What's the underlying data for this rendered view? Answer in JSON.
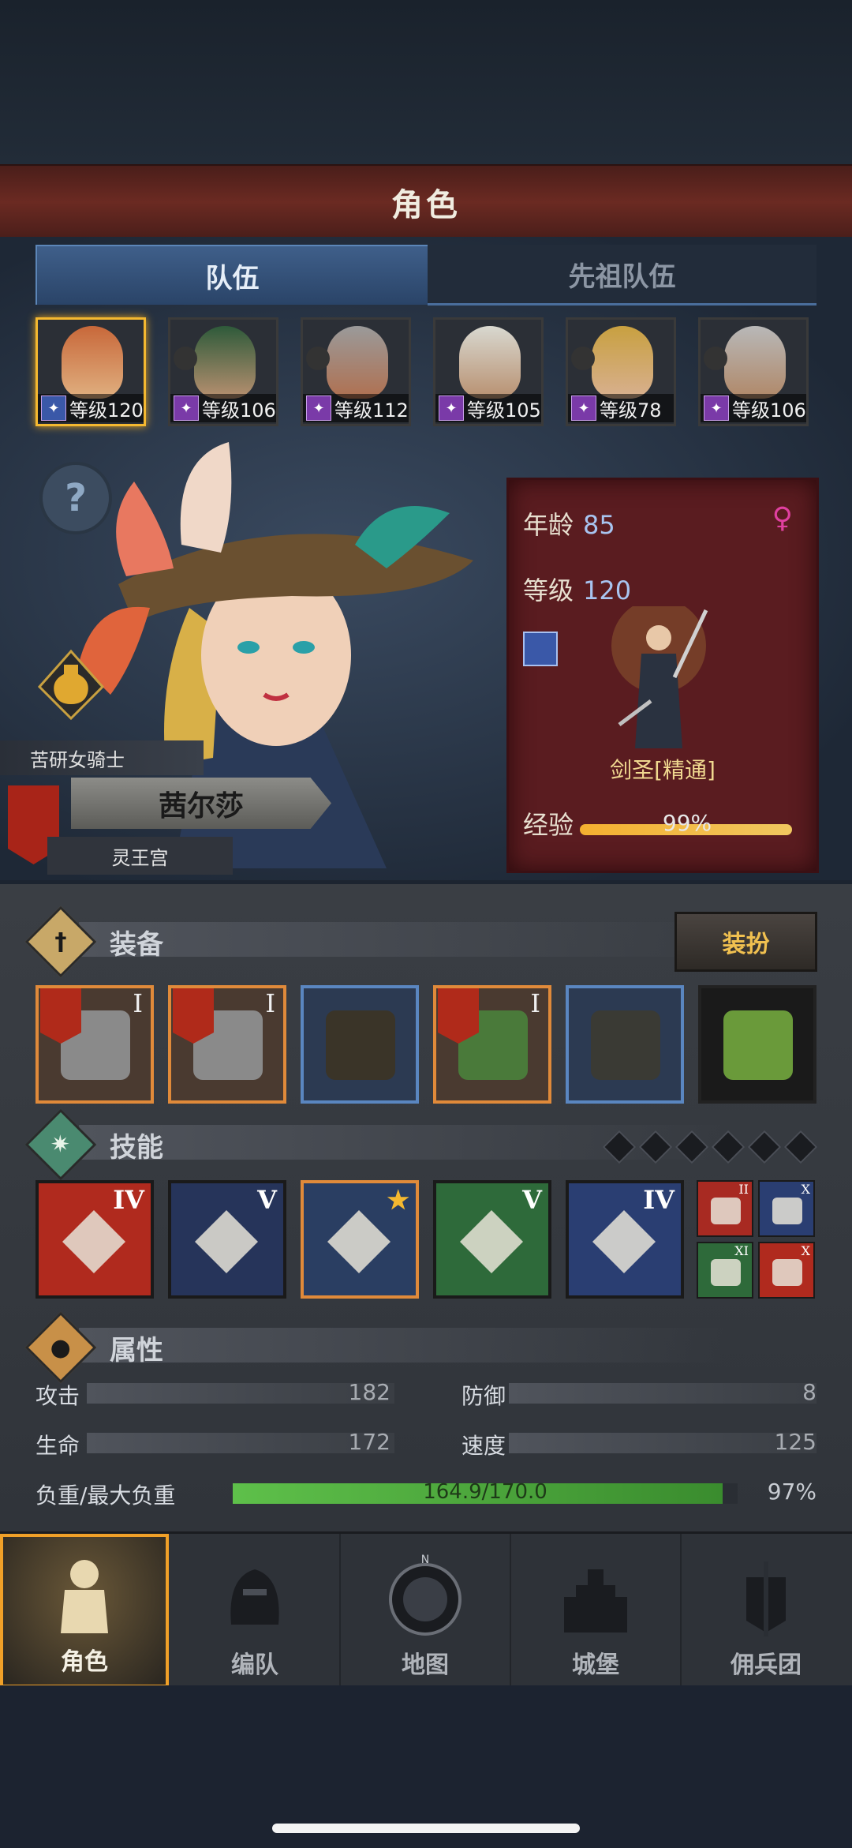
{
  "header": {
    "title": "角色"
  },
  "tabs": [
    {
      "label": "队伍"
    },
    {
      "label": "先祖队伍"
    }
  ],
  "party": [
    {
      "level_label": "等级120"
    },
    {
      "level_label": "等级106"
    },
    {
      "level_label": "等级112"
    },
    {
      "level_label": "等级105"
    },
    {
      "level_label": "等级78"
    },
    {
      "level_label": "等级106"
    }
  ],
  "hero": {
    "title": "苦研女骑士",
    "name": "茜尔莎",
    "faction": "灵王宫",
    "help_symbol": "?"
  },
  "info": {
    "age_label": "年龄",
    "age": "85",
    "gender_symbol": "♀",
    "level_label": "等级",
    "level": "120",
    "job": "剑圣[精通]",
    "exp_label": "经验",
    "exp_pct": "99%",
    "exp_fraction": 0.99
  },
  "equipment": {
    "title": "装备",
    "dress_button": "装扮",
    "slots": [
      {
        "icon": "halberd-icon",
        "rank": "I",
        "border": "orange"
      },
      {
        "icon": "halberd-icon",
        "rank": "I",
        "border": "orange"
      },
      {
        "icon": "hood-icon",
        "rank": "",
        "border": "blue"
      },
      {
        "icon": "leaf-armor-icon",
        "rank": "I",
        "border": "orange"
      },
      {
        "icon": "boots-icon",
        "rank": "",
        "border": "blue"
      },
      {
        "icon": "fruit-icon",
        "rank": "",
        "border": "dark"
      }
    ]
  },
  "skills": {
    "title": "技能",
    "main": [
      {
        "icon": "slash-skill-icon",
        "rank": "IV",
        "color": "#b02a1e"
      },
      {
        "icon": "burst-skill-icon",
        "rank": "V",
        "color": "#26345a"
      },
      {
        "icon": "blade-skill-icon",
        "rank": "★",
        "color": "#2a3e62"
      },
      {
        "icon": "target-skill-icon",
        "rank": "V",
        "color": "#2e6a3a"
      },
      {
        "icon": "crystal-skill-icon",
        "rank": "IV",
        "color": "#2a3e72"
      }
    ],
    "passive": [
      {
        "icon": "dumbbell-icon",
        "rank": "II",
        "color": "#a82a22"
      },
      {
        "icon": "wind-icon",
        "rank": "X",
        "color": "#2a3e72"
      },
      {
        "icon": "claw-icon",
        "rank": "XI",
        "color": "#2e6a3a"
      },
      {
        "icon": "sword-icon",
        "rank": "X",
        "color": "#b02a1e"
      }
    ]
  },
  "attributes": {
    "title": "属性",
    "attack_label": "攻击",
    "attack": "182",
    "defense_label": "防御",
    "defense": "8",
    "hp_label": "生命",
    "hp": "172",
    "speed_label": "速度",
    "speed": "125",
    "load_label": "负重/最大负重",
    "load_value": "164.9/170.0",
    "load_pct": "97%",
    "load_fraction": 0.97
  },
  "nav": [
    {
      "label": "角色"
    },
    {
      "label": "编队"
    },
    {
      "label": "地图"
    },
    {
      "label": "城堡"
    },
    {
      "label": "佣兵团"
    }
  ],
  "nav_compass": "N"
}
